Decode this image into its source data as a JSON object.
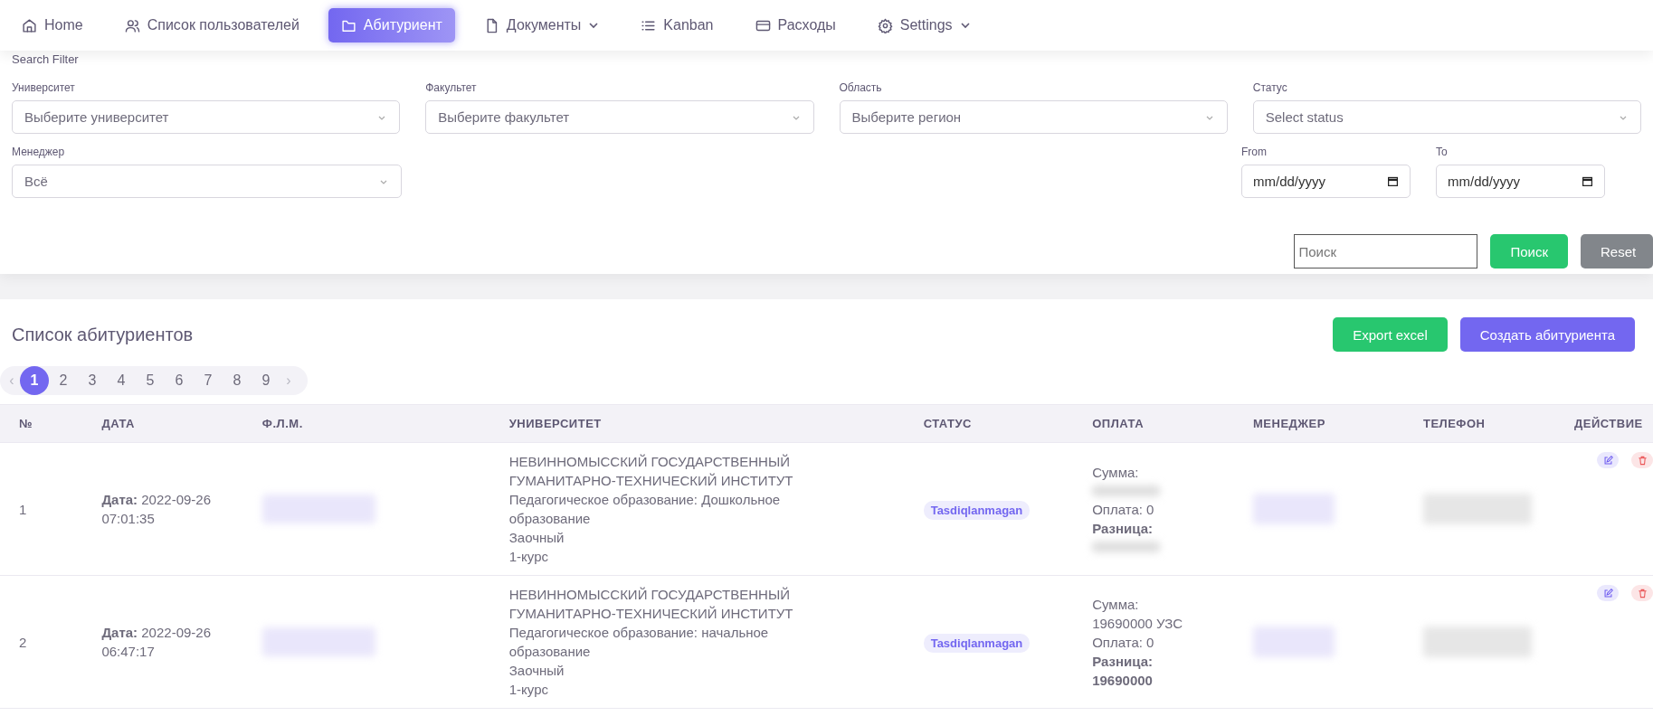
{
  "nav": [
    {
      "label": "Home",
      "selected": false,
      "dropdown": false
    },
    {
      "label": "Список пользователей",
      "selected": false,
      "dropdown": false
    },
    {
      "label": "Абитуриент",
      "selected": true,
      "dropdown": false
    },
    {
      "label": "Документы",
      "selected": false,
      "dropdown": true
    },
    {
      "label": "Kanban",
      "selected": false,
      "dropdown": false
    },
    {
      "label": "Расходы",
      "selected": false,
      "dropdown": false
    },
    {
      "label": "Settings",
      "selected": false,
      "dropdown": true
    }
  ],
  "filter": {
    "title": "Search Filter",
    "selects": [
      {
        "label": "Университет",
        "placeholder": "Выберите университет"
      },
      {
        "label": "Факультет",
        "placeholder": "Выберите факультет"
      },
      {
        "label": "Область",
        "placeholder": "Выберите регион"
      },
      {
        "label": "Статус",
        "placeholder": "Select status"
      }
    ],
    "manager": {
      "label": "Менеджер",
      "value": "Всё"
    },
    "dates": [
      {
        "label": "From",
        "placeholder": "mm/dd/yyyy"
      },
      {
        "label": "To",
        "placeholder": "mm/dd/yyyy"
      }
    ],
    "search": {
      "placeholder": "Поиск"
    },
    "buttons": [
      {
        "label": "Поиск",
        "kind": "success"
      },
      {
        "label": "Reset",
        "kind": "secondary"
      }
    ]
  },
  "list": {
    "title": "Список абитуриентов",
    "buttons": [
      {
        "label": "Export excel",
        "kind": "success"
      },
      {
        "label": "Создать абитуриента",
        "kind": "primary"
      }
    ],
    "pagination": {
      "prev": "‹",
      "next": "›",
      "pages": [
        {
          "label": "1",
          "selected": true
        },
        {
          "label": "2",
          "selected": false
        },
        {
          "label": "3",
          "selected": false
        },
        {
          "label": "4",
          "selected": false
        },
        {
          "label": "5",
          "selected": false
        },
        {
          "label": "6",
          "selected": false
        },
        {
          "label": "7",
          "selected": false
        },
        {
          "label": "8",
          "selected": false
        },
        {
          "label": "9",
          "selected": false
        }
      ]
    },
    "columns": [
      "№",
      "ДАТА",
      "Ф.Л.М.",
      "УНИВЕРСИТЕТ",
      "СТАТУС",
      "ОПЛАТА",
      "МЕНЕДЖЕР",
      "ТЕЛЕФОН",
      "ДЕЙСТВИЕ"
    ],
    "rows": [
      {
        "number": "1",
        "date": "**Дата:** 2022-09-26 07:01:35",
        "university": [
          "НЕВИННОМЫССКИЙ ГОСУДАРСТВЕННЫЙ ГУМАНИТАРНО-ТЕХНИЧЕСКИЙ ИНСТИТУТ",
          "Педагогическое образование: Дошкольное образование",
          "Заочный",
          "1-курс"
        ],
        "status": "Tasdiqlanmagan",
        "payment": [
          {
            "kind": "text",
            "text": "Сумма:"
          },
          {
            "kind": "hidden"
          },
          {
            "kind": "text",
            "text": "Оплата: 0"
          },
          {
            "kind": "bold",
            "text": "Разница:"
          },
          {
            "kind": "hidden"
          }
        ]
      },
      {
        "number": "2",
        "date": "**Дата:** 2022-09-26 06:47:17",
        "university": [
          "НЕВИННОМЫССКИЙ ГОСУДАРСТВЕННЫЙ ГУМАНИТАРНО-ТЕХНИЧЕСКИЙ ИНСТИТУТ",
          "Педагогическое образование: начальное образование",
          "Заочный",
          "1-курс"
        ],
        "status": "Tasdiqlanmagan",
        "payment": [
          {
            "kind": "text",
            "text": "Сумма:"
          },
          {
            "kind": "text",
            "text": "19690000 УЗС"
          },
          {
            "kind": "text",
            "text": "Оплата: 0"
          },
          {
            "kind": "bold",
            "text": "Разница:"
          },
          {
            "kind": "bold",
            "text": "19690000"
          }
        ]
      }
    ]
  }
}
